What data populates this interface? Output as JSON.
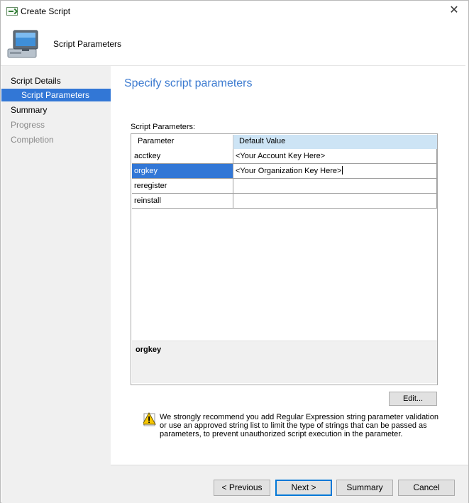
{
  "window": {
    "title": "Create Script",
    "close_glyph": "✕"
  },
  "header": {
    "title": "Script Parameters",
    "icon": "computer-icon"
  },
  "nav": {
    "items": [
      {
        "label": "Script Details",
        "state": "normal"
      },
      {
        "label": "Script Parameters",
        "state": "selected"
      },
      {
        "label": "Summary",
        "state": "normal"
      },
      {
        "label": "Progress",
        "state": "disabled"
      },
      {
        "label": "Completion",
        "state": "disabled"
      }
    ]
  },
  "main": {
    "heading": "Specify script parameters",
    "grid_label": "Script Parameters:",
    "columns": {
      "parameter": "Parameter",
      "default_value": "Default Value"
    },
    "rows": [
      {
        "name": "acctkey",
        "value": "<Your Account Key Here>"
      },
      {
        "name": "orgkey",
        "value": "<Your Organization Key Here>"
      },
      {
        "name": "reregister",
        "value": ""
      },
      {
        "name": "reinstall",
        "value": ""
      }
    ],
    "selected_row": "orgkey",
    "description_title": "orgkey",
    "edit_button": "Edit...",
    "warning": "We strongly recommend you add Regular Expression string parameter validation or use an approved string list to limit the type of strings that can be passed as parameters, to prevent unauthorized script execution in the parameter."
  },
  "footer": {
    "previous": "< Previous",
    "next": "Next >",
    "summary": "Summary",
    "cancel": "Cancel"
  },
  "colors": {
    "accent": "#3277d6",
    "heading": "#3b7ad0",
    "column_header": "#cde4f5",
    "panel": "#f0f0f0"
  }
}
